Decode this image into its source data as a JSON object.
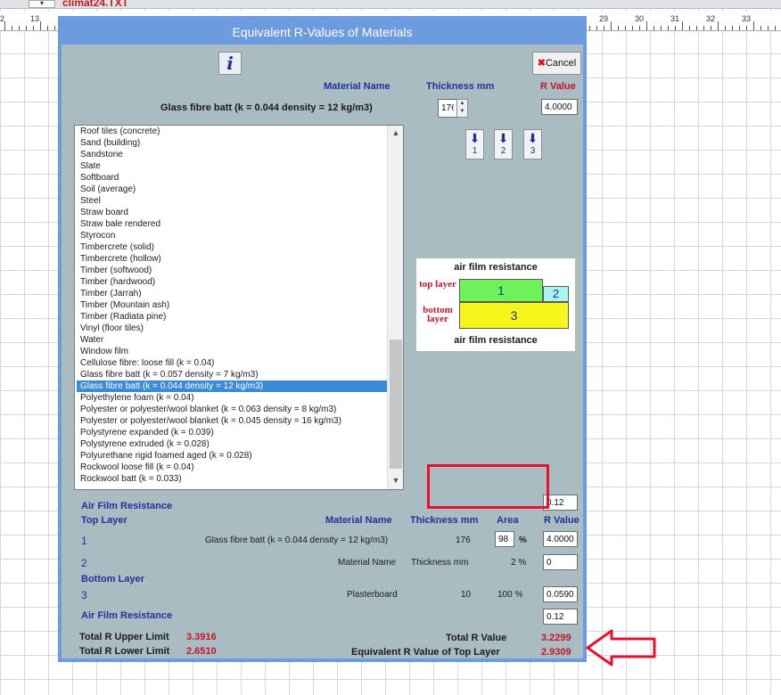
{
  "background": {
    "file_label": "climat24.TXT",
    "dropdown_arrow": "▾",
    "ruler_numbers": [
      "2",
      "13",
      "29",
      "30",
      "31",
      "32",
      "33"
    ]
  },
  "dialog": {
    "title": "Equivalent R-Values of Materials",
    "info_label": "i",
    "cancel_icon": "✖",
    "cancel_label": "Cancel",
    "header": {
      "material_name": "Material Name",
      "thickness_mm": "Thickness mm",
      "r_value": "R Value"
    },
    "selected_material": "Glass fibre batt (k = 0.044 density = 12 kg/m3)",
    "thickness_value": "176",
    "spin_up": "▲",
    "spin_down": "▼",
    "r_value": "4.0000",
    "layer_buttons": [
      {
        "arrow": "⬇",
        "label": "1"
      },
      {
        "arrow": "⬇",
        "label": "2"
      },
      {
        "arrow": "⬇",
        "label": "3"
      }
    ],
    "materials": [
      "Roof tiles (concrete)",
      "Sand (building)",
      "Sandstone",
      "Slate",
      "Softboard",
      "Soil (average)",
      "Steel",
      "Straw board",
      "Straw bale rendered",
      "Styrocon",
      "Timbercrete (solid)",
      "Timbercrete (hollow)",
      "Timber (softwood)",
      "Timber (hardwood)",
      "Timber (Jarrah)",
      "Timber (Mountain ash)",
      "Timber (Radiata pine)",
      "Vinyl (floor tiles)",
      "Water",
      "Window film",
      "Cellulose fibre: loose fill (k = 0.04)",
      "Glass fibre batt (k = 0.057 density = 7 kg/m3)",
      "Glass fibre batt (k = 0.044 density = 12 kg/m3)",
      "Polyethylene foam (k = 0.04)",
      "Polyester or polyester/wool blanket (k = 0.063 density = 8 kg/m3)",
      "Polyester or polyester/wool blanket (k = 0.045 density = 16 kg/m3)",
      "Polystyrene expanded (k = 0.039)",
      "Polystyrene extruded (k = 0.028)",
      "Polyurethane rigid foamed aged (k = 0.028)",
      "Rockwool loose fill (k = 0.04)",
      "Rockwool batt (k = 0.033)"
    ],
    "selected_index": 22,
    "scroll_up": "▲",
    "scroll_down": "▼",
    "diagram": {
      "top_caption": "air film resistance",
      "top_layer": "top layer",
      "bottom_layer": "bottom layer",
      "box1": "1",
      "box2": "2",
      "box3": "3",
      "bottom_caption": "air film resistance"
    },
    "table": {
      "air_film_top_value": "0.12",
      "air_film_resistance": "Air Film Resistance",
      "top_layer": "Top Layer",
      "bottom_layer": "Bottom Layer",
      "col_material": "Material Name",
      "col_thickness": "Thickness mm",
      "col_area": "Area",
      "col_rvalue": "R Value",
      "row1": {
        "num": "1",
        "material": "Glass fibre batt (k = 0.044 density = 12 kg/m3)",
        "thickness": "176",
        "area": "98",
        "pct": "%",
        "rvalue": "4.0000"
      },
      "row2": {
        "num": "2",
        "material": "Material Name",
        "thickness": "Thickness mm",
        "area": "2 %",
        "rvalue": "0"
      },
      "row3": {
        "num": "3",
        "material": "Plasterboard",
        "thickness": "10",
        "area": "100 %",
        "rvalue": "0.0590"
      },
      "air_film_bottom_value": "0.12"
    },
    "totals": {
      "upper_label": "Total R Upper Limit",
      "upper_value": "3.3916",
      "lower_label": "Total R Lower Limit",
      "lower_value": "2.6510",
      "total_r_label": "Total R Value",
      "total_r_value": "3.2299",
      "equivalent_label": "Equivalent R Value of Top Layer",
      "equivalent_value": "2.9309"
    }
  },
  "annotation_colors": {
    "highlight": "#e8112d",
    "dialog_bg": "#a9bcc2",
    "title_bar": "#6c9be0"
  }
}
